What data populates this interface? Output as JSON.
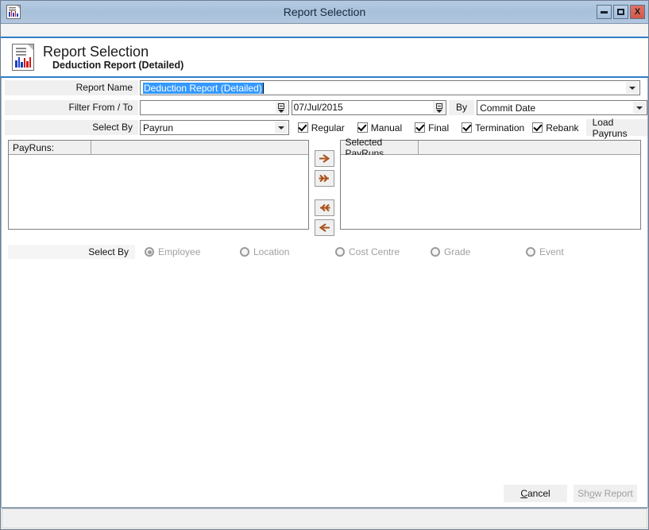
{
  "window": {
    "title": "Report Selection",
    "icon": "report-document-chart-icon",
    "buttons": {
      "minimize": "minimize-button",
      "maximize": "maximize-button",
      "close": "X"
    }
  },
  "header": {
    "title": "Report Selection",
    "subtitle": "Deduction Report (Detailed)",
    "icon": "report-document-chart-icon",
    "accent_color": "#2f7ec8"
  },
  "form": {
    "report_name": {
      "label": "Report Name",
      "value": "Deduction Report (Detailed)",
      "selected": true
    },
    "filter_from_to": {
      "label": "Filter From / To",
      "from_value": "",
      "from_placeholder": "",
      "to_value": "07/Jul/2015",
      "by_label": "By",
      "by_value": "Commit Date"
    },
    "select_by": {
      "label": "Select By",
      "value": "Payrun",
      "checkboxes": [
        {
          "label": "Regular",
          "checked": true
        },
        {
          "label": "Manual",
          "checked": true
        },
        {
          "label": "Final",
          "checked": true
        },
        {
          "label": "Termination",
          "checked": true
        },
        {
          "label": "Rebank",
          "checked": true
        }
      ],
      "load_button": "Load Payruns"
    }
  },
  "lists": {
    "available": {
      "header": "PayRuns:",
      "items": []
    },
    "selected": {
      "header": "Selected PayRuns",
      "items": []
    },
    "arrows": {
      "move_right": "single-right-arrow-icon",
      "move_all_right": "double-right-arrow-icon",
      "move_all_left": "double-left-arrow-icon",
      "move_left": "single-left-arrow-icon",
      "color": "#a8521a"
    }
  },
  "select_by_radio": {
    "label": "Select By",
    "options": [
      {
        "label": "Employee",
        "checked": true
      },
      {
        "label": "Location",
        "checked": false
      },
      {
        "label": "Cost Centre",
        "checked": false
      },
      {
        "label": "Grade",
        "checked": false
      },
      {
        "label": "Event",
        "checked": false
      }
    ],
    "disabled": true
  },
  "footer": {
    "cancel": {
      "pre": "",
      "acc": "C",
      "post": "ancel",
      "enabled": true
    },
    "show_report": {
      "pre": "Sh",
      "acc": "o",
      "post": "w Report",
      "enabled": false
    }
  },
  "statusbar": {
    "text": ""
  }
}
